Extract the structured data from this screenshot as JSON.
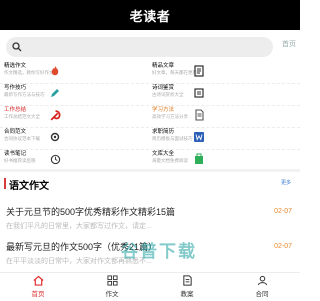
{
  "header": {
    "title": "老读者"
  },
  "search": {
    "placeholder": "",
    "icon": "search-icon"
  },
  "top_button": {
    "label": "首页"
  },
  "categories": [
    {
      "name": "精选作文",
      "desc": "作文精选，教你写好作文",
      "icon": "fire-icon",
      "color": "#e0492e"
    },
    {
      "name": "精品文章",
      "desc": "好文章，每天都在更新",
      "icon": "book-icon",
      "color": "#2b2b2b"
    },
    {
      "name": "写作技巧",
      "desc": "最新写作方法与技巧",
      "icon": "pencil-icon",
      "color": "#2aa0a0"
    },
    {
      "name": "诗词鉴赏",
      "desc": "古诗词赏析大全",
      "icon": "scroll-icon",
      "color": "#333333"
    },
    {
      "name": "工作总结",
      "desc": "工作总结范文大全",
      "icon": "party-emblem-icon",
      "color": "#d62020"
    },
    {
      "name": "学习方法",
      "desc": "高效学习方法分享",
      "icon": "document-icon",
      "color": "#555555"
    },
    {
      "name": "合同范文",
      "desc": "合同协议范本下载",
      "icon": "gear-icon",
      "color": "#333333"
    },
    {
      "name": "求职简历",
      "desc": "简历模板与面试技巧",
      "icon": "word-doc-icon",
      "color": "#2b5fb8"
    },
    {
      "name": "读书笔记",
      "desc": "好书推荐读后感",
      "icon": "clock-icon",
      "color": "#333333"
    },
    {
      "name": "文库大全",
      "desc": "海量文档免费阅读",
      "icon": "bag-icon",
      "color": "#2fae5a"
    }
  ],
  "section": {
    "title": "语文作文",
    "more": "更多"
  },
  "articles": [
    {
      "title": "关于元旦节的500字优秀精彩作文精彩15篇",
      "desc": "在我们平凡的日常里，大家都写过作文，请定...",
      "date": "02-07"
    },
    {
      "title": "最新写元旦的作文500字（优秀21篇）",
      "desc": "在平平淡淡的日常中，大家对作文都再熟悉不...",
      "date": "02-07"
    }
  ],
  "watermark": "谷普下载",
  "tabs": [
    {
      "label": "首页",
      "icon": "home-icon",
      "active": true
    },
    {
      "label": "作文",
      "icon": "grid-icon",
      "active": false
    },
    {
      "label": "教案",
      "icon": "document-icon",
      "active": false
    },
    {
      "label": "合同",
      "icon": "user-icon",
      "active": false
    }
  ],
  "colors": {
    "accent": "#e03030",
    "header_bg": "#000000",
    "date": "#e88a2e",
    "more": "#3a7bd5"
  }
}
